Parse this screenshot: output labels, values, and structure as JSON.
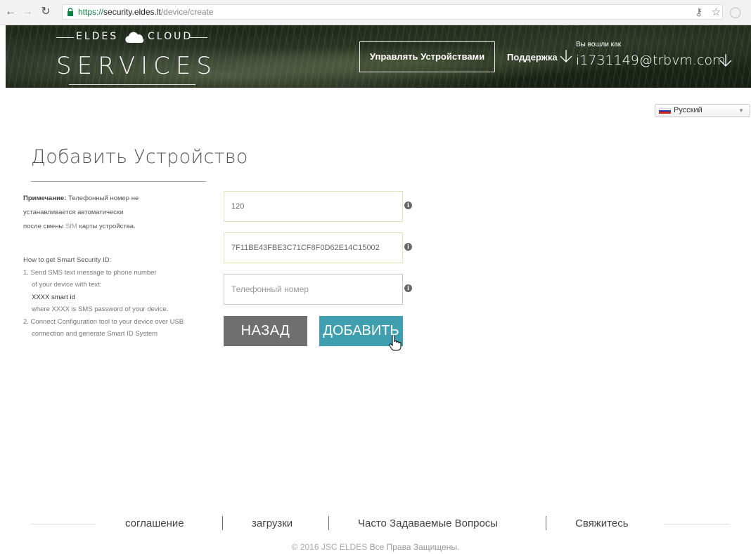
{
  "browser": {
    "url_scheme": "https://",
    "url_host": "security.eldes.lt",
    "url_path": "/device/create"
  },
  "header": {
    "logo_top_left": "ELDES",
    "logo_top_right": "CLOUD",
    "logo_main": "SERVICES",
    "manage_devices": "Управлять Устройствами",
    "support": "Поддержка",
    "logged_in_as": "Вы вошли как",
    "user_email": "i1731149@trbvm.com"
  },
  "language": {
    "selected": "Русский"
  },
  "page": {
    "title": "Добавить Устройство"
  },
  "note": {
    "label": "Примечание:",
    "line1": "Телефонный номер не",
    "line2": "устанавливается автоматически",
    "line3_a": "после смены ",
    "line3_sim": "SIM",
    "line3_b": " карты устройства."
  },
  "help": {
    "heading": "How to get Smart Security ID:",
    "step1_line1": "1. Send SMS text message to phone number",
    "step1_line2": "of your device with text:",
    "step1_code": "XXXX smart id",
    "step1_line3": "where XXXX is SMS password of your device.",
    "step2_line1": "2. Connect Configuration tool to your device over USB",
    "step2_line2": "connection and generate Smart ID System"
  },
  "form": {
    "field1_value": "120",
    "field2_value": "7F11BE43FBE3C71CF8F0D62E14C15002",
    "field3_placeholder": "Телефонный номер",
    "info_glyph": "i",
    "back_label": "НАЗАД",
    "add_label": "ДОБАВИТЬ"
  },
  "footer": {
    "agreement": "соглашение",
    "downloads": "загрузки",
    "faq": "Часто Задаваемые Вопросы",
    "contact": "Свяжитесь",
    "copyright_light": "© 2016 JSC ELDES ",
    "copyright_dark": "Все Права Защищены."
  },
  "colors": {
    "accent_button": "#3f9fae",
    "back_button": "#6f6f6f"
  }
}
